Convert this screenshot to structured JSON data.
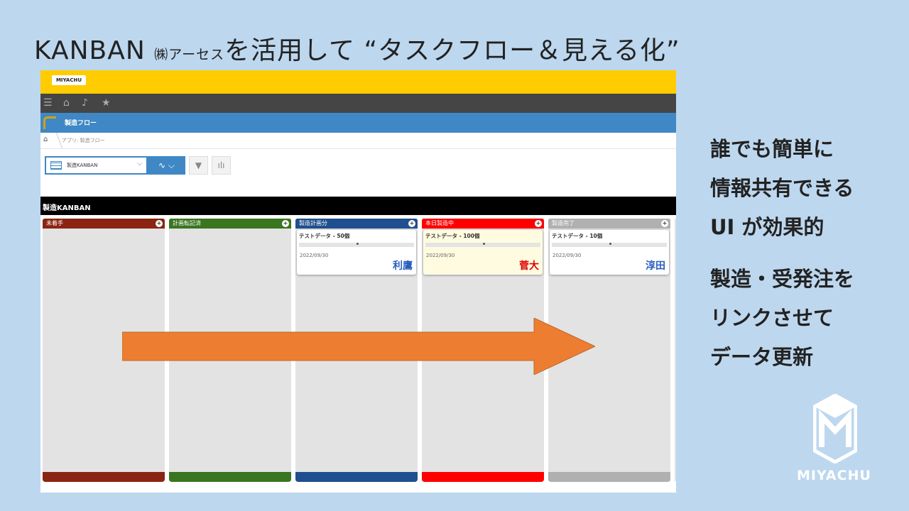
{
  "slide": {
    "title_prefix": "KANBAN ",
    "company": "㈱アーセス",
    "title_suffix": "を活用して “タスクフロー＆見える化”"
  },
  "app": {
    "logo_text": "MIYACHU",
    "app_name": "製造フロー",
    "breadcrumb": "アプリ: 製造フロー",
    "view_name": "製造KANBAN",
    "board_title": "製造KANBAN"
  },
  "lanes": [
    {
      "name": "未着手",
      "color": "#8b2412",
      "cards": []
    },
    {
      "name": "計画転記済",
      "color": "#3a7520",
      "cards": []
    },
    {
      "name": "製造計画分",
      "color": "#1f4f8e",
      "cards": [
        {
          "title": "テストデータ - 50個",
          "date": "2022/09/30",
          "person": "利鷹",
          "person_color": "#2a5fbf"
        }
      ]
    },
    {
      "name": "本日製造中",
      "color": "#ff0000",
      "cards": [
        {
          "title": "テストデータ - 100個",
          "date": "2022/09/30",
          "person": "菅大",
          "person_color": "#e00000"
        }
      ]
    },
    {
      "name": "製造完了",
      "color": "#b0b0b0",
      "cards": [
        {
          "title": "テストデータ - 10個",
          "date": "2022/09/30",
          "person": "淳田",
          "person_color": "#2a5fbf"
        }
      ]
    }
  ],
  "side_points": [
    "誰でも簡単に",
    "情報共有できる",
    "UI が効果的",
    "製造・受発注を",
    "リンクさせて",
    "データ更新"
  ],
  "brand": {
    "name": "MIYACHU"
  },
  "colors": {
    "background": "#bdd7ee",
    "arrow": "#ed7d31",
    "header": "#ffcc00",
    "app_bar": "#3f88c5"
  },
  "icons": [
    "menu-icon",
    "home-icon",
    "bell-icon",
    "star-icon",
    "filter-icon",
    "bar-chart-icon",
    "graph-icon"
  ]
}
